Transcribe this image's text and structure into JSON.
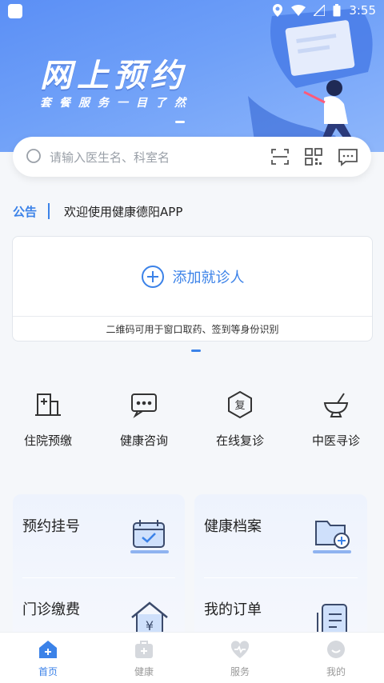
{
  "status_bar": {
    "time": "3:55"
  },
  "banner": {
    "title": "网上预约",
    "subtitle": "套餐服务一目了然"
  },
  "search": {
    "placeholder": "请输入医生名、科室名"
  },
  "notice": {
    "label": "公告",
    "text": "欢迎使用健康德阳APP"
  },
  "patient_card": {
    "add_label": "添加就诊人",
    "footer": "二维码可用于窗口取药、签到等身份识别"
  },
  "quick_services": [
    {
      "label": "住院预缴",
      "icon": "hospital-building-icon"
    },
    {
      "label": "健康咨询",
      "icon": "chat-bubble-icon"
    },
    {
      "label": "在线复诊",
      "icon": "revisit-hexagon-icon"
    },
    {
      "label": "中医寻诊",
      "icon": "mortar-pestle-icon"
    }
  ],
  "panels": {
    "appointment": {
      "label": "预约挂号",
      "icon": "calendar-check-icon"
    },
    "outpatient_pay": {
      "label": "门诊缴费",
      "icon": "yuan-house-icon"
    },
    "health_record": {
      "label": "健康档案",
      "icon": "folder-plus-icon"
    },
    "my_orders": {
      "label": "我的订单",
      "icon": "order-list-icon"
    }
  },
  "tabbar": [
    {
      "label": "首页",
      "icon": "home-icon",
      "active": true
    },
    {
      "label": "健康",
      "icon": "medical-kit-icon",
      "active": false
    },
    {
      "label": "服务",
      "icon": "heart-service-icon",
      "active": false
    },
    {
      "label": "我的",
      "icon": "profile-icon",
      "active": false
    }
  ],
  "colors": {
    "accent": "#3b82e8",
    "banner": "#5b8ff5",
    "panel": "#eef3fd"
  }
}
